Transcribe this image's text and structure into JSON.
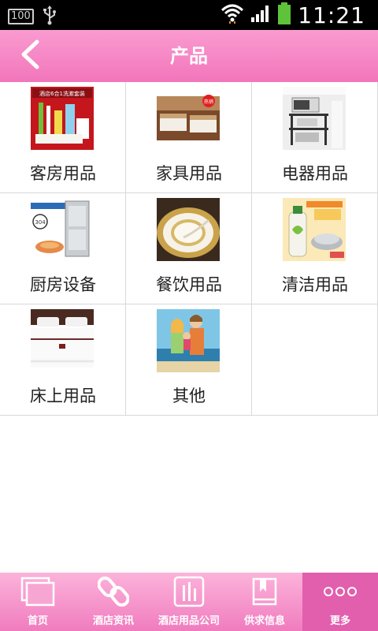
{
  "status_bar": {
    "battery_badge": "100",
    "time": "11:21",
    "icons": [
      "usb-icon",
      "wifi-icon",
      "signal-icon",
      "battery-icon"
    ]
  },
  "header": {
    "title": "产品",
    "back_icon": "chevron-left-icon"
  },
  "products": [
    {
      "label": "客房用品",
      "image_text": "酒店6合1洗漱套装"
    },
    {
      "label": "家具用品",
      "image_text": "热销"
    },
    {
      "label": "电器用品"
    },
    {
      "label": "厨房设备",
      "image_text": "304"
    },
    {
      "label": "餐饮用品"
    },
    {
      "label": "清洁用品"
    },
    {
      "label": "床上用品"
    },
    {
      "label": "其他"
    }
  ],
  "bottom_nav": [
    {
      "label": "首页",
      "icon": "pages-icon",
      "active": false
    },
    {
      "label": "酒店资讯",
      "icon": "link-icon",
      "active": false
    },
    {
      "label": "酒店用品公司",
      "icon": "chart-icon",
      "active": false
    },
    {
      "label": "供求信息",
      "icon": "book-icon",
      "active": false
    },
    {
      "label": "更多",
      "icon": "more-icon",
      "active": true
    }
  ],
  "colors": {
    "header": "#f275bb",
    "nav": "#f07cbf",
    "nav_active": "#e25fad"
  }
}
